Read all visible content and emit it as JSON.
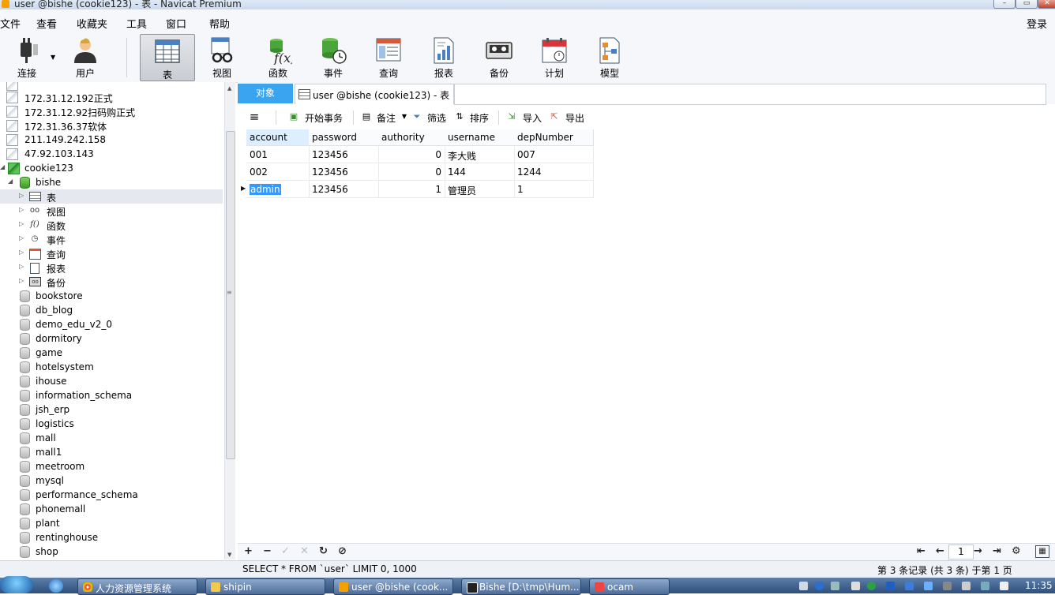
{
  "window": {
    "title": "user @bishe (cookie123) - 表 - Navicat Premium"
  },
  "menu": {
    "items": [
      "文件",
      "查看",
      "收藏夹",
      "工具",
      "窗口",
      "帮助"
    ],
    "login": "登录"
  },
  "toolbar": {
    "items": [
      {
        "label": "连接",
        "icon": "plug-icon"
      },
      {
        "label": "用户",
        "icon": "user-icon"
      },
      {
        "label": "表",
        "icon": "table-icon",
        "active": true
      },
      {
        "label": "视图",
        "icon": "view-glasses-icon"
      },
      {
        "label": "函数",
        "icon": "function-icon"
      },
      {
        "label": "事件",
        "icon": "event-clock-icon"
      },
      {
        "label": "查询",
        "icon": "query-icon"
      },
      {
        "label": "报表",
        "icon": "report-icon"
      },
      {
        "label": "备份",
        "icon": "backup-tape-icon"
      },
      {
        "label": "计划",
        "icon": "calendar-icon"
      },
      {
        "label": "模型",
        "icon": "model-icon"
      }
    ]
  },
  "sidebar": {
    "connections": [
      "172.31.12.192正式",
      "172.31.12.92扫码购正式",
      "172.31.36.37软体",
      "211.149.242.158",
      "47.92.103.143"
    ],
    "active_connection": "cookie123",
    "active_db": "bishe",
    "db_children": [
      "表",
      "视图",
      "函数",
      "事件",
      "查询",
      "报表",
      "备份"
    ],
    "databases": [
      "bookstore",
      "db_blog",
      "demo_edu_v2_0",
      "dormitory",
      "game",
      "hotelsystem",
      "ihouse",
      "information_schema",
      "jsh_erp",
      "logistics",
      "mall",
      "mall1",
      "meetroom",
      "mysql",
      "performance_schema",
      "phonemall",
      "plant",
      "rentinghouse",
      "shop"
    ]
  },
  "tabs": {
    "objects": "对象",
    "active": "user @bishe (cookie123) - 表"
  },
  "subtoolbar": {
    "begin_tx": "开始事务",
    "note": "备注",
    "filter": "筛选",
    "sort": "排序",
    "import": "导入",
    "export": "导出"
  },
  "grid": {
    "columns": [
      "account",
      "password",
      "authority",
      "username",
      "depNumber"
    ],
    "rows": [
      [
        "001",
        "123456",
        "0",
        "李大贱",
        "007"
      ],
      [
        "002",
        "123456",
        "0",
        "144",
        "1244"
      ],
      [
        "admin",
        "123456",
        "1",
        "管理员",
        "1"
      ]
    ]
  },
  "pager": {
    "page": "1"
  },
  "status": {
    "sql": "SELECT * FROM `user` LIMIT 0, 1000",
    "records": "第 3 条记录 (共 3 条) 于第 1 页"
  },
  "taskbar": {
    "items": [
      "人力资源管理系统",
      "shipin",
      "user @bishe (cook...",
      "Bishe [D:\\tmp\\Hum...",
      "ocam"
    ],
    "clock": "11:35"
  }
}
